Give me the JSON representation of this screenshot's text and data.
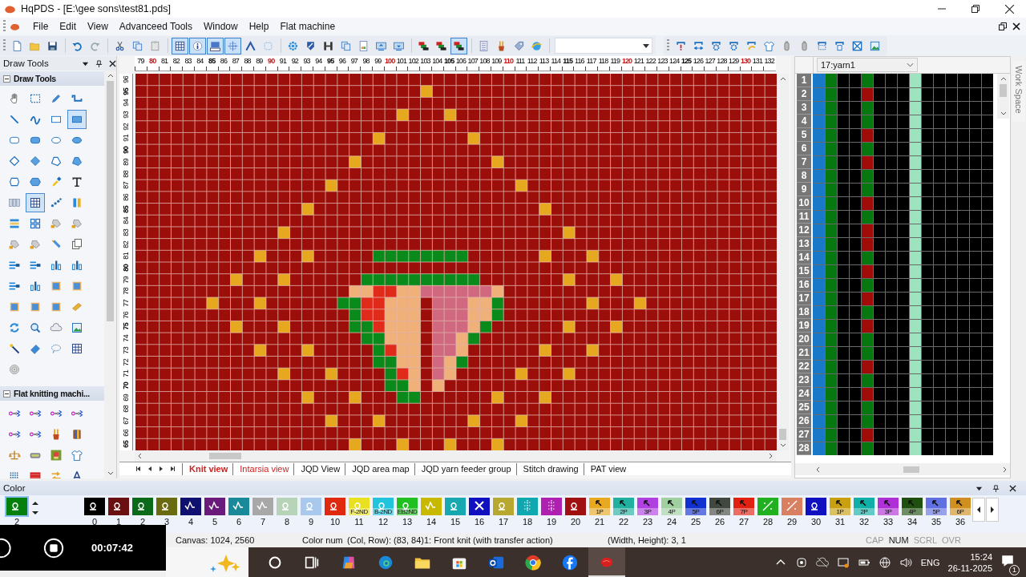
{
  "window": {
    "title": "HqPDS - [E:\\gee sons\\test81.pds]"
  },
  "menu": [
    "File",
    "Edit",
    "View",
    "Advanceed Tools",
    "Window",
    "Help",
    "Flat machine"
  ],
  "toolbar": {
    "groups": [
      [
        {
          "kind": "doc",
          "selected": false
        },
        {
          "kind": "folder",
          "selected": false
        },
        {
          "kind": "disk",
          "selected": false
        }
      ],
      [
        {
          "kind": "undo",
          "selected": false
        },
        {
          "kind": "redo",
          "selected": false
        }
      ],
      [
        {
          "kind": "scissors",
          "selected": false
        },
        {
          "kind": "copy",
          "selected": false
        },
        {
          "kind": "paste",
          "selected": false
        }
      ],
      [
        {
          "kind": "grid",
          "selected": true
        },
        {
          "kind": "info",
          "selected": true
        },
        {
          "kind": "iconview",
          "selected": true
        },
        {
          "kind": "crosshair",
          "selected": true
        },
        {
          "kind": "arch",
          "selected": false
        },
        {
          "kind": "dotsquare",
          "selected": false
        }
      ],
      [
        {
          "kind": "flower",
          "selected": false
        },
        {
          "kind": "shield",
          "selected": false
        },
        {
          "kind": "hbar",
          "selected": false
        },
        {
          "kind": "copy",
          "selected": false
        },
        {
          "kind": "page",
          "selected": false
        },
        {
          "kind": "monitorup",
          "selected": false
        },
        {
          "kind": "monitordown",
          "selected": false
        }
      ],
      [
        {
          "kind": "layers",
          "selected": false
        },
        {
          "kind": "layers",
          "selected": false
        },
        {
          "kind": "layers",
          "selected": true
        }
      ],
      [
        {
          "kind": "calc",
          "selected": false
        },
        {
          "kind": "brush",
          "selected": false
        },
        {
          "kind": "tag",
          "selected": false
        },
        {
          "kind": "globe",
          "selected": false
        }
      ]
    ],
    "right": [
      {
        "kind": "framebang",
        "selected": false
      },
      {
        "kind": "framearrows",
        "selected": false
      },
      {
        "kind": "framegear",
        "selected": false
      },
      {
        "kind": "framegear",
        "selected": false
      },
      {
        "kind": "framearrow",
        "selected": false
      },
      {
        "kind": "shirt",
        "selected": false
      },
      {
        "kind": "bottle",
        "selected": false
      },
      {
        "kind": "bottle",
        "selected": false
      },
      {
        "kind": "framedots",
        "selected": false
      },
      {
        "kind": "framenum",
        "selected": false
      },
      {
        "kind": "framex",
        "selected": false
      },
      {
        "kind": "image",
        "selected": false
      }
    ]
  },
  "draw_tools": {
    "title": "Draw Tools",
    "sections": [
      {
        "title": "Draw Tools",
        "expanded": true,
        "tools": [
          {
            "kind": "hand",
            "selected": false
          },
          {
            "kind": "marquee",
            "selected": false
          },
          {
            "kind": "pencil",
            "selected": false
          },
          {
            "kind": "step",
            "selected": false
          },
          {
            "kind": "line",
            "selected": false
          },
          {
            "kind": "wave",
            "selected": false
          },
          {
            "kind": "rect",
            "selected": false
          },
          {
            "kind": "rectfill",
            "selected": true
          },
          {
            "kind": "rrect",
            "selected": false
          },
          {
            "kind": "rrectfill",
            "selected": false
          },
          {
            "kind": "oval",
            "selected": false
          },
          {
            "kind": "ovalfill",
            "selected": false
          },
          {
            "kind": "diamond",
            "selected": false
          },
          {
            "kind": "diamondfill",
            "selected": false
          },
          {
            "kind": "quad",
            "selected": false
          },
          {
            "kind": "quadfill",
            "selected": false
          },
          {
            "kind": "poly",
            "selected": false
          },
          {
            "kind": "polyfill",
            "selected": false
          },
          {
            "kind": "dropper",
            "selected": false
          },
          {
            "kind": "letter",
            "selected": false
          },
          {
            "kind": "cols",
            "selected": false
          },
          {
            "kind": "grid",
            "selected": true
          },
          {
            "kind": "dots",
            "selected": false
          },
          {
            "kind": "bars",
            "selected": false
          },
          {
            "kind": "rows",
            "selected": false
          },
          {
            "kind": "squares",
            "selected": false
          },
          {
            "kind": "bucket",
            "selected": false
          },
          {
            "kind": "bucket",
            "selected": false
          },
          {
            "kind": "bucket",
            "selected": false
          },
          {
            "kind": "bucket",
            "selected": false
          },
          {
            "kind": "pen",
            "selected": false
          },
          {
            "kind": "pages",
            "selected": false
          },
          {
            "kind": "align",
            "selected": false
          },
          {
            "kind": "align",
            "selected": false
          },
          {
            "kind": "chart",
            "selected": false
          },
          {
            "kind": "chart",
            "selected": false
          },
          {
            "kind": "align",
            "selected": false
          },
          {
            "kind": "chart",
            "selected": false
          },
          {
            "kind": "frame",
            "selected": false
          },
          {
            "kind": "frame",
            "selected": false
          },
          {
            "kind": "frame",
            "selected": false
          },
          {
            "kind": "frame",
            "selected": false
          },
          {
            "kind": "frame",
            "selected": false
          },
          {
            "kind": "goldbar",
            "selected": false
          },
          {
            "kind": "refresh",
            "selected": false
          },
          {
            "kind": "magnifier",
            "selected": false
          },
          {
            "kind": "cloud",
            "selected": false
          },
          {
            "kind": "image",
            "selected": false
          },
          {
            "kind": "wand",
            "selected": false
          },
          {
            "kind": "eraser",
            "selected": false
          },
          {
            "kind": "lasso",
            "selected": false
          },
          {
            "kind": "grid",
            "selected": false
          },
          {
            "kind": "target",
            "selected": false
          }
        ]
      },
      {
        "title": "Flat knitting machi...",
        "expanded": true,
        "tools": [
          {
            "kind": "transfer",
            "selected": false
          },
          {
            "kind": "transfer",
            "selected": false
          },
          {
            "kind": "transfer",
            "selected": false
          },
          {
            "kind": "transfer",
            "selected": false
          },
          {
            "kind": "transfer",
            "selected": false
          },
          {
            "kind": "transfer",
            "selected": false
          },
          {
            "kind": "brush",
            "selected": false
          },
          {
            "kind": "book",
            "selected": false
          },
          {
            "kind": "scale",
            "selected": false
          },
          {
            "kind": "device",
            "selected": false
          },
          {
            "kind": "badge",
            "selected": false
          },
          {
            "kind": "shirt",
            "selected": false
          },
          {
            "kind": "needles",
            "selected": false
          },
          {
            "kind": "redblock",
            "selected": false
          },
          {
            "kind": "arrows",
            "selected": false
          },
          {
            "kind": "compass",
            "selected": false
          }
        ]
      }
    ]
  },
  "canvas": {
    "columns": [
      {
        "label": "79",
        "kind": "one"
      },
      {
        "label": "80",
        "kind": "ten"
      },
      {
        "label": "81",
        "kind": "one"
      },
      {
        "label": "82",
        "kind": "one"
      },
      {
        "label": "83",
        "kind": "one"
      },
      {
        "label": "84",
        "kind": "one"
      },
      {
        "label": "85",
        "kind": "five"
      },
      {
        "label": "86",
        "kind": "one"
      },
      {
        "label": "87",
        "kind": "one"
      },
      {
        "label": "88",
        "kind": "one"
      },
      {
        "label": "89",
        "kind": "one"
      },
      {
        "label": "90",
        "kind": "ten"
      },
      {
        "label": "91",
        "kind": "one"
      },
      {
        "label": "92",
        "kind": "one"
      },
      {
        "label": "93",
        "kind": "one"
      },
      {
        "label": "94",
        "kind": "one"
      },
      {
        "label": "95",
        "kind": "five"
      },
      {
        "label": "96",
        "kind": "one"
      },
      {
        "label": "97",
        "kind": "one"
      },
      {
        "label": "98",
        "kind": "one"
      },
      {
        "label": "99",
        "kind": "one"
      },
      {
        "label": "100",
        "kind": "ten"
      },
      {
        "label": "101",
        "kind": "one"
      },
      {
        "label": "102",
        "kind": "one"
      },
      {
        "label": "103",
        "kind": "one"
      },
      {
        "label": "104",
        "kind": "one"
      },
      {
        "label": "105",
        "kind": "five"
      },
      {
        "label": "106",
        "kind": "one"
      },
      {
        "label": "107",
        "kind": "one"
      },
      {
        "label": "108",
        "kind": "one"
      },
      {
        "label": "109",
        "kind": "one"
      },
      {
        "label": "110",
        "kind": "ten"
      },
      {
        "label": "111",
        "kind": "one"
      },
      {
        "label": "112",
        "kind": "one"
      },
      {
        "label": "113",
        "kind": "one"
      },
      {
        "label": "114",
        "kind": "one"
      },
      {
        "label": "115",
        "kind": "five"
      },
      {
        "label": "116",
        "kind": "one"
      },
      {
        "label": "117",
        "kind": "one"
      },
      {
        "label": "118",
        "kind": "one"
      },
      {
        "label": "119",
        "kind": "one"
      },
      {
        "label": "120",
        "kind": "ten"
      },
      {
        "label": "121",
        "kind": "one"
      },
      {
        "label": "122",
        "kind": "one"
      },
      {
        "label": "123",
        "kind": "one"
      },
      {
        "label": "124",
        "kind": "one"
      },
      {
        "label": "125",
        "kind": "five"
      },
      {
        "label": "126",
        "kind": "one"
      },
      {
        "label": "127",
        "kind": "one"
      },
      {
        "label": "128",
        "kind": "one"
      },
      {
        "label": "129",
        "kind": "one"
      },
      {
        "label": "130",
        "kind": "ten"
      },
      {
        "label": "131",
        "kind": "one"
      },
      {
        "label": "132",
        "kind": "one"
      }
    ],
    "rows": [
      {
        "label": "96",
        "kind": "one"
      },
      {
        "label": "95",
        "kind": "five"
      },
      {
        "label": "94",
        "kind": "one"
      },
      {
        "label": "93",
        "kind": "one"
      },
      {
        "label": "92",
        "kind": "one"
      },
      {
        "label": "91",
        "kind": "one"
      },
      {
        "label": "90",
        "kind": "ten"
      },
      {
        "label": "89",
        "kind": "one"
      },
      {
        "label": "88",
        "kind": "one"
      },
      {
        "label": "87",
        "kind": "one"
      },
      {
        "label": "86",
        "kind": "one"
      },
      {
        "label": "85",
        "kind": "five"
      },
      {
        "label": "84",
        "kind": "one"
      },
      {
        "label": "83",
        "kind": "one"
      },
      {
        "label": "82",
        "kind": "one"
      },
      {
        "label": "81",
        "kind": "one"
      },
      {
        "label": "80",
        "kind": "ten"
      },
      {
        "label": "79",
        "kind": "one"
      },
      {
        "label": "78",
        "kind": "one"
      },
      {
        "label": "77",
        "kind": "one"
      },
      {
        "label": "76",
        "kind": "one"
      },
      {
        "label": "75",
        "kind": "five"
      },
      {
        "label": "74",
        "kind": "one"
      },
      {
        "label": "73",
        "kind": "one"
      },
      {
        "label": "72",
        "kind": "one"
      },
      {
        "label": "71",
        "kind": "one"
      },
      {
        "label": "70",
        "kind": "ten"
      },
      {
        "label": "69",
        "kind": "one"
      },
      {
        "label": "68",
        "kind": "one"
      },
      {
        "label": "67",
        "kind": "one"
      },
      {
        "label": "66",
        "kind": "one"
      },
      {
        "label": "65",
        "kind": "five"
      }
    ],
    "tabs": [
      {
        "label": "Knit view",
        "selected": true,
        "highlighted": true
      },
      {
        "label": "Intarsia view",
        "selected": false,
        "highlighted": true
      },
      {
        "label": "JQD View",
        "selected": false,
        "highlighted": false
      },
      {
        "label": "JQD area map",
        "selected": false,
        "highlighted": false
      },
      {
        "label": "JQD yarn feeder group",
        "selected": false,
        "highlighted": false
      },
      {
        "label": "Stitch drawing",
        "selected": false,
        "highlighted": false
      },
      {
        "label": "PAT view",
        "selected": false,
        "highlighted": false
      }
    ]
  },
  "yarn_panel": {
    "yarn": "17:yarn1",
    "rows": [
      "1",
      "2",
      "3",
      "4",
      "5",
      "6",
      "7",
      "8",
      "9",
      "10",
      "11",
      "12",
      "13",
      "14",
      "15",
      "16",
      "17",
      "18",
      "19",
      "20",
      "21",
      "22",
      "23",
      "24",
      "25",
      "26",
      "27",
      "28"
    ],
    "columns": [
      {
        "color": "#1a78c8"
      },
      {
        "color": "#06780f"
      },
      {
        "color": "#000000"
      },
      {
        "color": "#000000"
      },
      {
        "cells": [
          {
            "color": "#06780f"
          },
          {
            "color": "#a00c08"
          },
          {
            "color": "#06780f"
          },
          {
            "color": "#06780f"
          },
          {
            "color": "#a00c08"
          },
          {
            "color": "#06780f"
          },
          {
            "color": "#a00c08"
          },
          {
            "color": "#06780f"
          },
          {
            "color": "#06780f"
          },
          {
            "color": "#a00c08"
          },
          {
            "color": "#06780f"
          },
          {
            "color": "#a00c08"
          },
          {
            "color": "#a00c08"
          },
          {
            "color": "#06780f"
          },
          {
            "color": "#a00c08"
          },
          {
            "color": "#06780f"
          },
          {
            "color": "#a00c08"
          },
          {
            "color": "#06780f"
          },
          {
            "color": "#a00c08"
          },
          {
            "color": "#06780f"
          },
          {
            "color": "#06780f"
          },
          {
            "color": "#a00c08"
          },
          {
            "color": "#06780f"
          },
          {
            "color": "#a00c08"
          },
          {
            "color": "#06780f"
          },
          {
            "color": "#06780f"
          },
          {
            "color": "#a00c08"
          },
          {
            "color": "#06780f"
          }
        ]
      },
      {
        "color": "#000000"
      },
      {
        "color": "#000000"
      },
      {
        "color": "#000000"
      },
      {
        "color": "#9ee3bf"
      },
      {
        "color": "#000000"
      },
      {
        "color": "#000000"
      },
      {
        "color": "#000000"
      },
      {
        "color": "#000000"
      },
      {
        "color": "#000000"
      },
      {
        "color": "#000000"
      }
    ]
  },
  "workspace_tab": "Work Space",
  "color_panel": {
    "title": "Color",
    "current": {
      "label": "2",
      "color": "#06800c",
      "kind": "loop"
    },
    "swatches": [
      {
        "label": "0",
        "color": "#000000",
        "kind": "loop"
      },
      {
        "label": "1",
        "color": "#6a1010",
        "kind": "loop"
      },
      {
        "label": "2",
        "color": "#0a6a1a",
        "kind": "loop"
      },
      {
        "label": "3",
        "color": "#6a6a10",
        "kind": "loop"
      },
      {
        "label": "4",
        "color": "#101070",
        "kind": "wave"
      },
      {
        "label": "5",
        "color": "#6a1a7a",
        "kind": "wave"
      },
      {
        "label": "6",
        "color": "#1a8a9a",
        "kind": "wave"
      },
      {
        "label": "7",
        "color": "#a8a8a8",
        "kind": "wave"
      },
      {
        "label": "8",
        "color": "#b8d4b8",
        "kind": "loop"
      },
      {
        "label": "9",
        "color": "#a8c8ec",
        "kind": "loop"
      },
      {
        "label": "10",
        "color": "#e02a10",
        "kind": "loop"
      },
      {
        "label": "11",
        "color": "#e8e020",
        "kind": "loop",
        "text": "F-2ND"
      },
      {
        "label": "12",
        "color": "#22c4dc",
        "kind": "loop",
        "text": "B-2ND"
      },
      {
        "label": "13",
        "color": "#20c020",
        "kind": "loop",
        "text": "EB2ND"
      },
      {
        "label": "14",
        "color": "#c8b800",
        "kind": "wave"
      },
      {
        "label": "15",
        "color": "#18a8b0",
        "kind": "loop"
      },
      {
        "label": "16",
        "color": "#1010c0",
        "kind": "cross"
      },
      {
        "label": "17",
        "color": "#b8a830",
        "kind": "loop"
      },
      {
        "label": "18",
        "color": "#10a8b0",
        "kind": "dots"
      },
      {
        "label": "19",
        "color": "#b020b0",
        "kind": "dots"
      },
      {
        "label": "20",
        "color": "#a01010",
        "kind": "loop"
      },
      {
        "label": "21",
        "color": "#e8a820",
        "kind": "arrow",
        "text": "1P"
      },
      {
        "label": "22",
        "color": "#20b0a0",
        "kind": "arrow",
        "text": "2P"
      },
      {
        "label": "23",
        "color": "#b040e0",
        "kind": "arrow",
        "text": "3P"
      },
      {
        "label": "24",
        "color": "#a0d0a0",
        "kind": "arrow",
        "text": "4P"
      },
      {
        "label": "25",
        "color": "#1030d0",
        "kind": "arrow",
        "text": "5P"
      },
      {
        "label": "26",
        "color": "#404840",
        "kind": "arrow",
        "text": "6P"
      },
      {
        "label": "27",
        "color": "#e02010",
        "kind": "arrow",
        "text": "7P"
      },
      {
        "label": "28",
        "color": "#20b020",
        "kind": "slash"
      },
      {
        "label": "29",
        "color": "#d88060",
        "kind": "slash"
      },
      {
        "label": "30",
        "color": "#1010c0",
        "kind": "loop"
      },
      {
        "label": "31",
        "color": "#c8a010",
        "kind": "arrow",
        "text": "1P"
      },
      {
        "label": "32",
        "color": "#10b0a8",
        "kind": "arrow",
        "text": "2P"
      },
      {
        "label": "33",
        "color": "#b030d8",
        "kind": "arrow",
        "text": "3P"
      },
      {
        "label": "34",
        "color": "#205010",
        "kind": "arrow",
        "text": "4P"
      },
      {
        "label": "35",
        "color": "#6070e0",
        "kind": "arrow",
        "text": "5P"
      },
      {
        "label": "36",
        "color": "#d09020",
        "kind": "arrow",
        "text": "6P"
      }
    ]
  },
  "status_bar": {
    "canvas": "Canvas: 1024, 2560",
    "color_num": "Color num",
    "position": "(Col, Row): (83, 84)1: Front knit (with transfer action)",
    "size": "(Width, Height): 3, 1",
    "indicators": [
      {
        "text": "CAP",
        "on": false
      },
      {
        "text": "NUM",
        "on": true
      },
      {
        "text": "SCRL",
        "on": false
      },
      {
        "text": "OVR",
        "on": false
      }
    ]
  },
  "taskbar": {
    "apps": [
      {
        "kind": "search",
        "active": false
      },
      {
        "kind": "taskview",
        "active": false
      },
      {
        "kind": "copilot",
        "active": false
      },
      {
        "kind": "edge",
        "active": false
      },
      {
        "kind": "files",
        "active": false
      },
      {
        "kind": "store",
        "active": false
      },
      {
        "kind": "outlook",
        "active": false
      },
      {
        "kind": "chrome",
        "active": false
      },
      {
        "kind": "facebook",
        "active": false
      },
      {
        "kind": "knit",
        "active": true
      }
    ],
    "language": "ENG",
    "time": "15:24",
    "date": "26-11-2025",
    "notifications": "1"
  },
  "overlays": {
    "recording_time": "00:07:42"
  }
}
